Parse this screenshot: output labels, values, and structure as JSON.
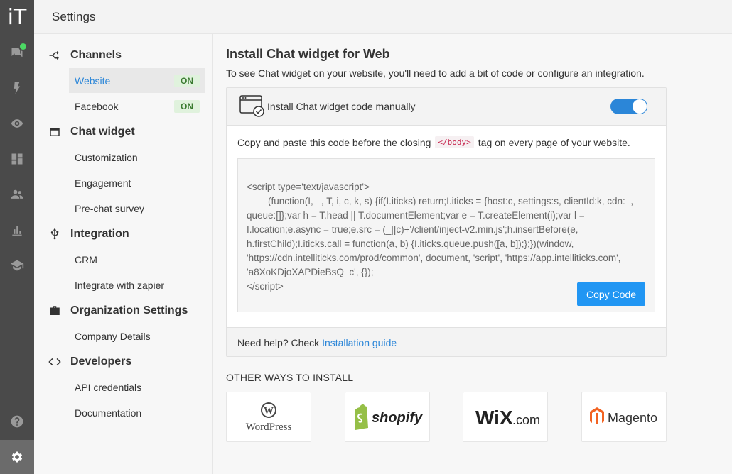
{
  "rail": {
    "logo": "iT",
    "icons": [
      "chat-icon",
      "bolt-icon",
      "eye-icon",
      "dashboard-icon",
      "people-icon",
      "bar-chart-icon",
      "graduation-cap-icon",
      "help-icon",
      "settings-gear-icon"
    ],
    "online_color": "#4cd964"
  },
  "header": {
    "title": "Settings"
  },
  "nav": {
    "channels": {
      "label": "Channels",
      "items": [
        {
          "label": "Website",
          "badge": "ON"
        },
        {
          "label": "Facebook",
          "badge": "ON"
        }
      ]
    },
    "chat_widget": {
      "label": "Chat widget",
      "items": [
        "Customization",
        "Engagement",
        "Pre-chat survey"
      ]
    },
    "integration": {
      "label": "Integration",
      "items": [
        "CRM",
        "Integrate with zapier"
      ]
    },
    "organization": {
      "label": "Organization Settings",
      "items": [
        "Company Details"
      ]
    },
    "developers": {
      "label": "Developers",
      "items": [
        "API credentials",
        "Documentation"
      ]
    }
  },
  "main": {
    "title": "Install Chat widget for Web",
    "subtitle": "To see Chat widget on your website, you'll need to add a bit of code or configure an integration.",
    "card": {
      "header": "Install Chat widget code manually",
      "toggle_on": true,
      "instruction_before": "Copy and paste this code before the closing",
      "instruction_tag": "</body>",
      "instruction_after": "tag on every page of your website.",
      "code": "<script type='text/javascript'>\n        (function(I, _, T, i, c, k, s) {if(I.iticks) return;I.iticks = {host:c, settings:s, clientId:k, cdn:_, queue:[]};var h = T.head || T.documentElement;var e = T.createElement(i);var l = I.location;e.async = true;e.src = (_||c)+'/client/inject-v2.min.js';h.insertBefore(e, h.firstChild);I.iticks.call = function(a, b) {I.iticks.queue.push([a, b]);};})(window, 'https://cdn.intelliticks.com/prod/common', document, 'script', 'https://app.intelliticks.com', 'a8XoKDjoXAPDieBsQ_c', {});\n</script>",
      "copy_button": "Copy Code",
      "help_text": "Need help? Check",
      "help_link": "Installation guide"
    },
    "other_title": "OTHER WAYS TO INSTALL",
    "integrations": [
      {
        "name": "WordPress",
        "logo_text": "WordPress"
      },
      {
        "name": "Shopify",
        "logo_text": "shopify"
      },
      {
        "name": "Wix",
        "logo_text": "WiX",
        "logo_suffix": ".com"
      },
      {
        "name": "Magento",
        "logo_text": "Magento"
      }
    ]
  },
  "colors": {
    "accent": "#2b86d8",
    "button": "#2196f3",
    "rail": "#4a4a4a",
    "badge_bg": "#e0f2dd",
    "shopify_green": "#95bf47",
    "magento_orange": "#f26322"
  }
}
